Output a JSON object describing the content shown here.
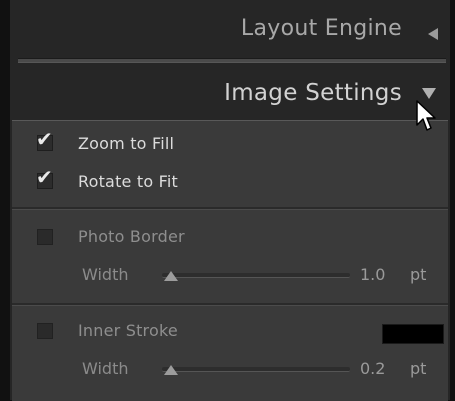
{
  "panels": {
    "layout_engine": {
      "title": "Layout Engine",
      "state": "collapsed"
    },
    "image_settings": {
      "title": "Image Settings",
      "state": "expanded"
    }
  },
  "image_settings": {
    "zoom_to_fill": {
      "label": "Zoom to Fill",
      "checked": true
    },
    "rotate_to_fit": {
      "label": "Rotate to Fit",
      "checked": true
    },
    "photo_border": {
      "label": "Photo Border",
      "checked": false,
      "width_label": "Width",
      "width_value": "1.0",
      "unit": "pt",
      "slider_fraction": 0.05
    },
    "inner_stroke": {
      "label": "Inner Stroke",
      "checked": false,
      "color": "#000000",
      "width_label": "Width",
      "width_value": "0.2",
      "unit": "pt",
      "slider_fraction": 0.05
    }
  },
  "icons": {
    "checkmark": "✔",
    "collapsed_triangle": "triangle-left",
    "expanded_triangle": "triangle-down",
    "cursor": "arrow-pointer"
  },
  "colors": {
    "panel_bg": "#262626",
    "content_bg": "#3a3a3a",
    "swatch": "#000000"
  }
}
